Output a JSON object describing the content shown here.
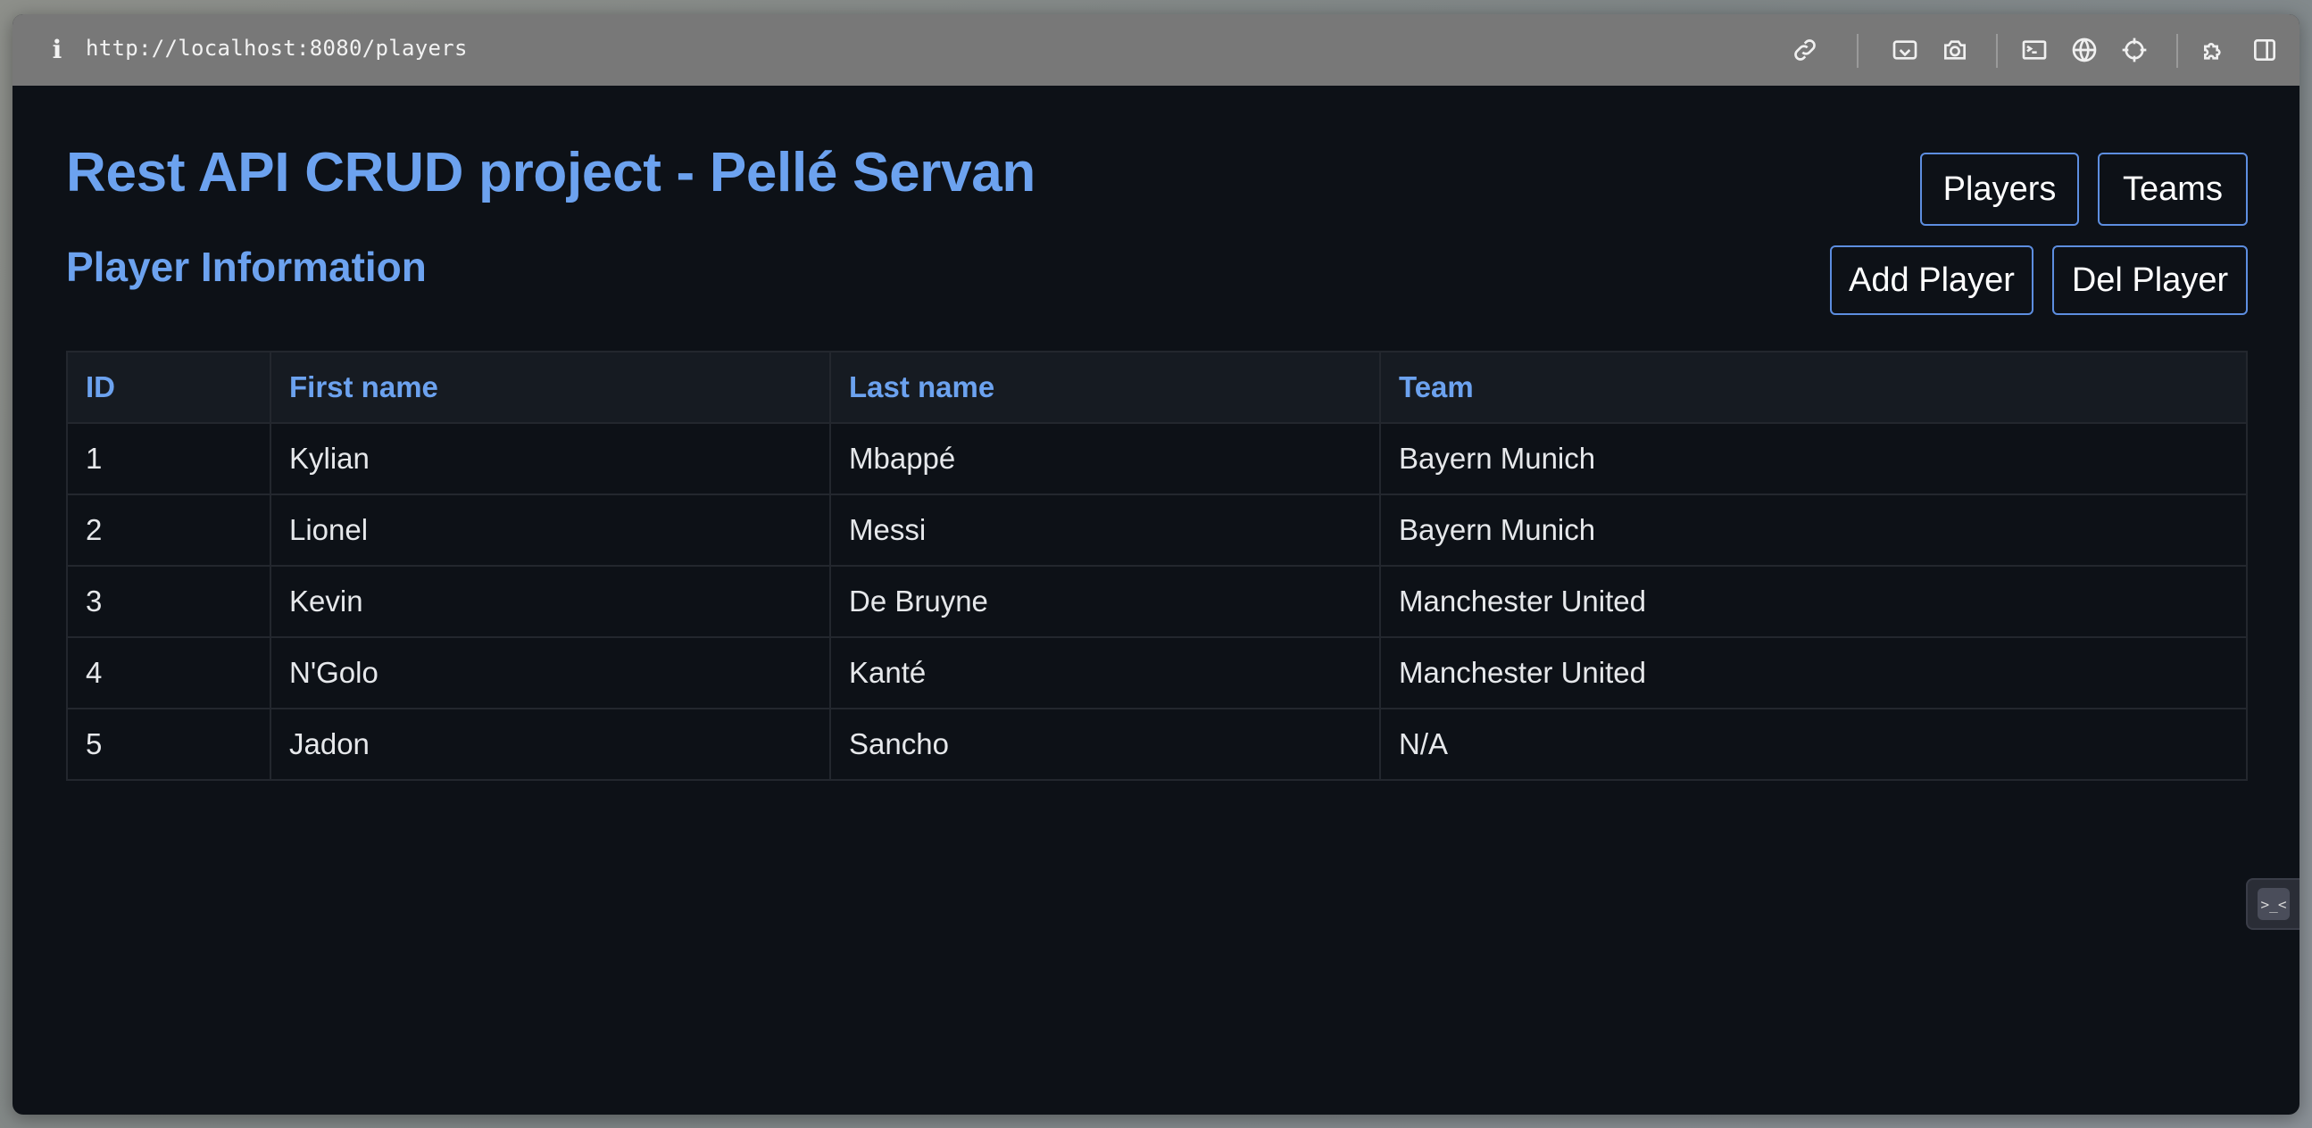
{
  "browser": {
    "url": "http://localhost:8080/players",
    "info_glyph": "i",
    "toolbar_icons": [
      "link-icon",
      "screenshot-icon",
      "camera-icon",
      "terminal-icon",
      "globe-icon",
      "crosshair-icon",
      "extension-icon",
      "sidebar-icon"
    ]
  },
  "header": {
    "title": "Rest API CRUD project - Pellé Servan",
    "subtitle": "Player Information",
    "nav": {
      "players_label": "Players",
      "teams_label": "Teams"
    },
    "actions": {
      "add_label": "Add Player",
      "del_label": "Del Player"
    }
  },
  "table": {
    "columns": [
      "ID",
      "First name",
      "Last name",
      "Team"
    ],
    "rows": [
      [
        "1",
        "Kylian",
        "Mbappé",
        "Bayern Munich"
      ],
      [
        "2",
        "Lionel",
        "Messi",
        "Bayern Munich"
      ],
      [
        "3",
        "Kevin",
        "De Bruyne",
        "Manchester United"
      ],
      [
        "4",
        "N'Golo",
        "Kanté",
        "Manchester United"
      ],
      [
        "5",
        "Jadon",
        "Sancho",
        "N/A"
      ]
    ]
  },
  "widget": {
    "glyph": ">_<"
  },
  "colors": {
    "accent": "#6ca2ef",
    "background": "#0d1117",
    "button_border": "#5d8ee0"
  }
}
